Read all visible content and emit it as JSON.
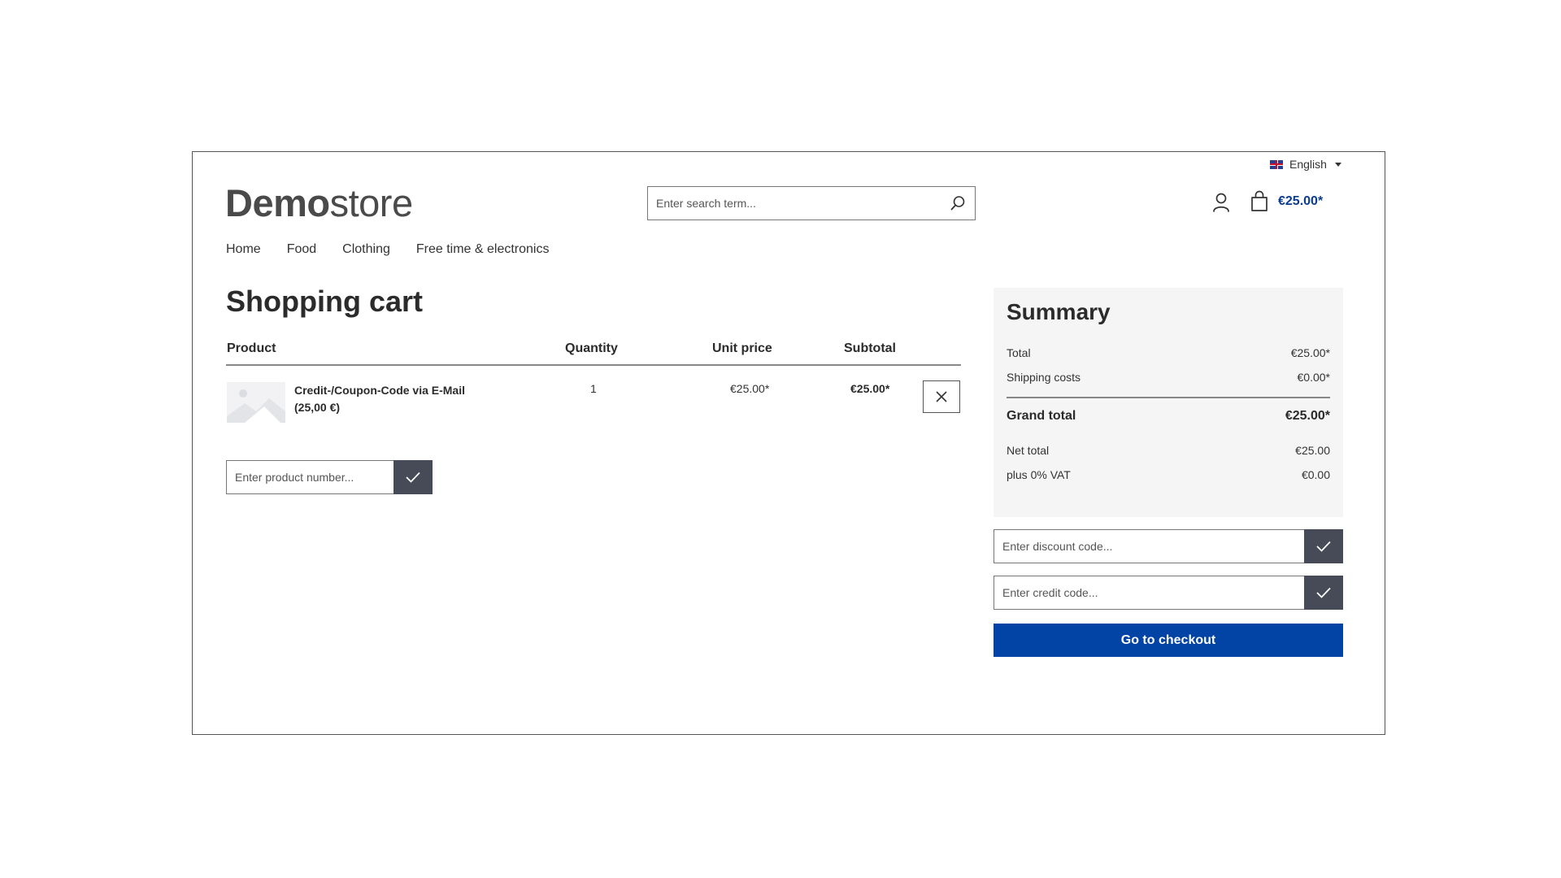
{
  "header": {
    "language": "English",
    "logo_bold": "Demo",
    "logo_light": "store",
    "search_placeholder": "Enter search term...",
    "cart_total": "€25.00*"
  },
  "nav": {
    "items": [
      {
        "label": "Home"
      },
      {
        "label": "Food"
      },
      {
        "label": "Clothing"
      },
      {
        "label": "Free time & electronics"
      }
    ]
  },
  "cart": {
    "title": "Shopping cart",
    "columns": {
      "product": "Product",
      "quantity": "Quantity",
      "unit_price": "Unit price",
      "subtotal": "Subtotal"
    },
    "items": [
      {
        "name": "Credit-/Coupon-Code via E-Mail (25,00 €)",
        "quantity": "1",
        "unit_price": "€25.00*",
        "subtotal": "€25.00*"
      }
    ],
    "product_number_placeholder": "Enter product number..."
  },
  "summary": {
    "title": "Summary",
    "total_label": "Total",
    "total_value": "€25.00*",
    "shipping_label": "Shipping costs",
    "shipping_value": "€0.00*",
    "grand_label": "Grand total",
    "grand_value": "€25.00*",
    "net_label": "Net total",
    "net_value": "€25.00",
    "vat_label": "plus 0% VAT",
    "vat_value": "€0.00"
  },
  "codes": {
    "discount_placeholder": "Enter discount code...",
    "credit_placeholder": "Enter credit code..."
  },
  "checkout_label": "Go to checkout",
  "colors": {
    "accent": "#0144a5",
    "dark_button": "#474a57",
    "summary_bg": "#f5f5f5"
  }
}
